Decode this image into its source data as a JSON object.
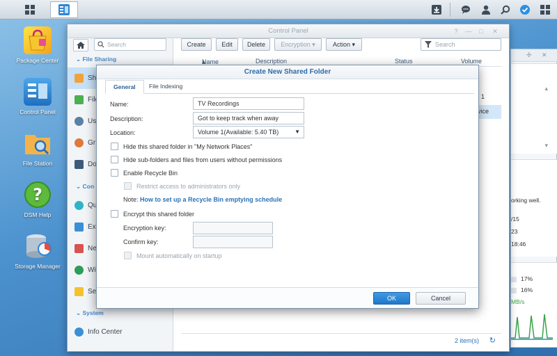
{
  "taskbar": {
    "icons": [
      "main-menu-icon",
      "control-panel-app-icon",
      "download-icon",
      "chat-icon",
      "user-icon",
      "search-icon",
      "widgets-icon",
      "apps-icon"
    ]
  },
  "desktop": {
    "icons": [
      {
        "label": "Package Center"
      },
      {
        "label": "Control Panel"
      },
      {
        "label": "File Station"
      },
      {
        "label": "DSM Help"
      },
      {
        "label": "Storage Manager"
      }
    ]
  },
  "widgets": {
    "status_text": "orking well.",
    "row1": "/15",
    "row2": "23",
    "row3": "18:46",
    "cpu": "17%",
    "ram": "16%",
    "speed": "MB/s"
  },
  "control_panel": {
    "title": "Control Panel",
    "side_search_placeholder": "Search",
    "sections": {
      "file_sharing": "File Sharing",
      "connectivity": "Con",
      "system": "System"
    },
    "side_items": [
      "Shar",
      "File",
      "Us",
      "Gr",
      "Do",
      "Qu",
      "Ex",
      "Ne",
      "Wi",
      "Se",
      "Info Center"
    ],
    "toolbar": {
      "create": "Create",
      "edit": "Edit",
      "delete": "Delete",
      "encryption": "Encryption",
      "action": "Action",
      "filter_placeholder": "Search"
    },
    "grid_headers": {
      "name": "Name",
      "description": "Description",
      "status": "Status",
      "volume": "Volume"
    },
    "grid_partial": [
      "e 1",
      "vice"
    ],
    "status_count": "2 item(s)"
  },
  "dialog": {
    "title": "Create New Shared Folder",
    "tabs": [
      "General",
      "File Indexing"
    ],
    "fields": {
      "name_label": "Name:",
      "name_value": "TV Recordings",
      "description_label": "Description:",
      "description_value": "Got to keep track when away",
      "location_label": "Location:",
      "location_value": "Volume 1(Available: 5.40 TB)"
    },
    "checkboxes": {
      "hide_network": "Hide this shared folder in \"My Network Places\"",
      "hide_subfolders": "Hide sub-folders and files from users without permissions",
      "recycle_bin": "Enable Recycle Bin",
      "restrict_admin": "Restrict access to administrators only",
      "encrypt": "Encrypt this shared folder",
      "mount_startup": "Mount automatically on startup"
    },
    "note_prefix": "Note:",
    "note_link": "How to set up a Recycle Bin emptying schedule",
    "encryption_key_label": "Encryption key:",
    "confirm_key_label": "Confirm key:",
    "ok": "OK",
    "cancel": "Cancel"
  }
}
